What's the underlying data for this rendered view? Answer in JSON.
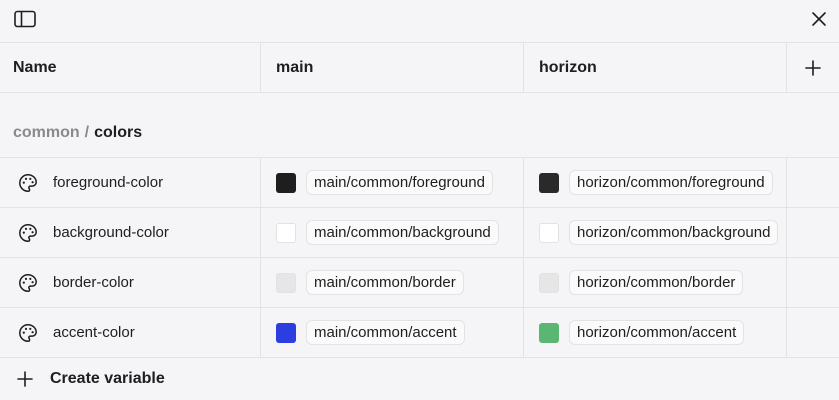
{
  "toolbar": {
    "sidebar_icon": "sidebar-toggle-icon",
    "close_icon": "close-icon"
  },
  "table": {
    "columns": [
      {
        "label": "Name"
      },
      {
        "label": "main"
      },
      {
        "label": "horizon"
      }
    ],
    "add_column_icon": "plus-icon"
  },
  "group": {
    "parent": "common",
    "separator": "/",
    "name": "colors"
  },
  "variables": [
    {
      "icon": "palette-icon",
      "name": "foreground-color",
      "main": {
        "swatch": "#1e1e1e",
        "alias": "main/common/foreground"
      },
      "horizon": {
        "swatch": "#2a2a2a",
        "alias": "horizon/common/foreground"
      }
    },
    {
      "icon": "palette-icon",
      "name": "background-color",
      "main": {
        "swatch": "#ffffff",
        "alias": "main/common/background"
      },
      "horizon": {
        "swatch": "#ffffff",
        "alias": "horizon/common/background"
      }
    },
    {
      "icon": "palette-icon",
      "name": "border-color",
      "main": {
        "swatch": "#e6e6e6",
        "alias": "main/common/border"
      },
      "horizon": {
        "swatch": "#e6e6e6",
        "alias": "horizon/common/border"
      }
    },
    {
      "icon": "palette-icon",
      "name": "accent-color",
      "main": {
        "swatch": "#2c3ee0",
        "alias": "main/common/accent"
      },
      "horizon": {
        "swatch": "#5bb673",
        "alias": "horizon/common/accent"
      }
    }
  ],
  "create": {
    "icon": "plus-icon",
    "label": "Create variable"
  }
}
